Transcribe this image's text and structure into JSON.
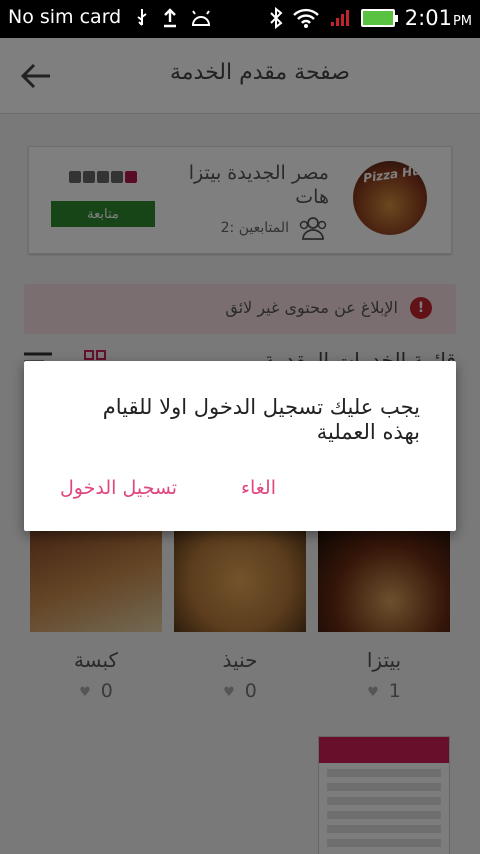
{
  "status_bar": {
    "carrier": "No sim card",
    "time": "2:01",
    "ampm": "PM"
  },
  "app_bar": {
    "title": "صفحة مقدم الخدمة"
  },
  "provider": {
    "name": "مصر الجديدة بيتزا هات",
    "followers_label": "المتابعين :2",
    "follow_button": "متابعة",
    "avatar_logo": "Pizza Hut"
  },
  "report": {
    "label": "الإبلاغ عن محتوى غير لائق"
  },
  "services": {
    "title": "قائمة الخدمات المقدمة"
  },
  "products": [
    {
      "name": "بيتزا",
      "likes": "1"
    },
    {
      "name": "حنيذ",
      "likes": "0"
    },
    {
      "name": "كبسة",
      "likes": "0"
    }
  ],
  "dialog": {
    "message": "يجب عليك تسجيل الدخول اولا للقيام بهذه العملية",
    "cancel": "الغاء",
    "login": "تسجيل الدخول"
  },
  "colors": {
    "accent": "#e0467f",
    "follow": "#2f8a2f",
    "report_bg": "#f5dde0"
  }
}
